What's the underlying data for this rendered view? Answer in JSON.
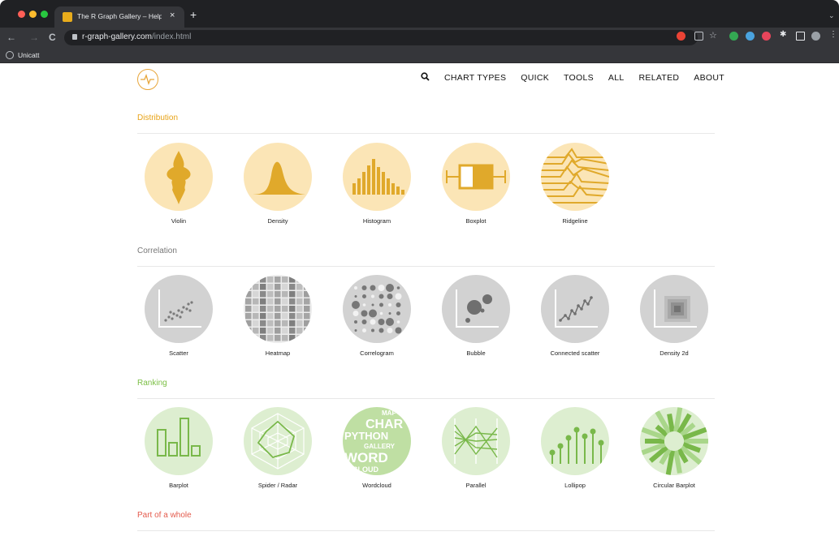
{
  "browser": {
    "tab_title": "The R Graph Gallery – Help an",
    "tab_close": "×",
    "new_tab": "+",
    "url_domain": "r-graph-gallery.com",
    "url_path": "/index.html",
    "bookmark_label": "Unicatt",
    "nav_back": "←",
    "nav_forward": "→",
    "nav_reload": "C"
  },
  "header": {
    "search_icon": "search-icon",
    "search_glyph": "Q",
    "nav": [
      "CHART TYPES",
      "QUICK",
      "TOOLS",
      "ALL",
      "RELATED",
      "ABOUT"
    ]
  },
  "sections": [
    {
      "title": "Distribution",
      "color": "#e8a317",
      "items": [
        "Violin",
        "Density",
        "Histogram",
        "Boxplot",
        "Ridgeline"
      ]
    },
    {
      "title": "Correlation",
      "color": "#777777",
      "items": [
        "Scatter",
        "Heatmap",
        "Correlogram",
        "Bubble",
        "Connected scatter",
        "Density 2d"
      ]
    },
    {
      "title": "Ranking",
      "color": "#7bbf45",
      "items": [
        "Barplot",
        "Spider / Radar",
        "Wordcloud",
        "Parallel",
        "Lollipop",
        "Circular Barplot"
      ]
    },
    {
      "title": "Part of a whole",
      "color": "#e45b4d",
      "items": []
    }
  ],
  "wordcloud_words": [
    "MAF",
    "CHAR",
    "PYTHON",
    "GALLERY",
    "WORD",
    "CLOUD"
  ],
  "colors": {
    "dist_bg": "#fbe5b6",
    "dist_fg": "#e0a92b",
    "corr_bg": "#d2d2d2",
    "corr_fg": "#8a8a8a",
    "rank_bg": "#ddeed0",
    "rank_fg": "#79b84a"
  }
}
